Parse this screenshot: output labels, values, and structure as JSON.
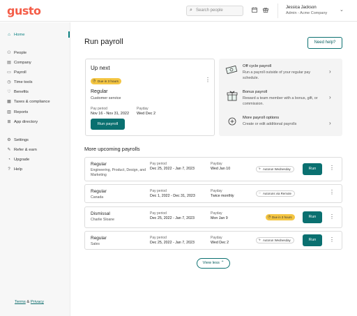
{
  "brand": {
    "logo_text": "gusto",
    "accent": "#f45d48",
    "primary": "#0a7070"
  },
  "topbar": {
    "search_placeholder": "Search people",
    "search_icon": "search-icon",
    "calendar_icon": "calendar-icon",
    "gift_icon": "gift-icon",
    "user_name": "Jessica Jackson",
    "user_company": "Admin - Acme Company",
    "chevron": "chevron-down-icon"
  },
  "sidebar": {
    "items": [
      {
        "label": "Home",
        "icon": "home-icon",
        "active": true
      },
      {
        "label": "People",
        "icon": "people-icon"
      },
      {
        "label": "Company",
        "icon": "company-icon"
      },
      {
        "label": "Payroll",
        "icon": "payroll-icon"
      },
      {
        "label": "Time tools",
        "icon": "clock-icon"
      },
      {
        "label": "Benefits",
        "icon": "heart-icon"
      },
      {
        "label": "Taxes & compliance",
        "icon": "taxes-icon"
      },
      {
        "label": "Reports",
        "icon": "reports-icon"
      },
      {
        "label": "App directory",
        "icon": "apps-icon"
      },
      {
        "label": "Settings",
        "icon": "gear-icon"
      },
      {
        "label": "Refer & earn",
        "icon": "refer-icon"
      },
      {
        "label": "Upgrade",
        "icon": "upgrade-icon"
      },
      {
        "label": "Help",
        "icon": "help-icon"
      }
    ],
    "footer": {
      "terms": "Terms",
      "amp": "&",
      "privacy": "Privacy"
    }
  },
  "main": {
    "title": "Run payroll",
    "help_button": "Need help?",
    "up_next": {
      "title": "Up next",
      "badge": "Due in 3 hours",
      "type": "Regular",
      "description": "Customer service",
      "pay_period_label": "Pay period",
      "pay_period": "Nov 16 - Nov 31, 2022",
      "payday_label": "Payday",
      "payday": "Wed Dec 2",
      "run_button": "Run payroll"
    },
    "options": [
      {
        "title": "Off cycle payroll",
        "description": "Run a payroll outside of your regular pay schedule.",
        "icon": "money-icon"
      },
      {
        "title": "Bonus payroll",
        "description": "Reward a team member with a bonus, gift, or commission.",
        "icon": "gift-box-icon"
      },
      {
        "title": "More payroll options",
        "description": "Create or edit additional payrolls",
        "icon": "plus-circle-icon"
      }
    ],
    "upcoming_title": "More upcoming payrolls",
    "upcoming": [
      {
        "type": "Regular",
        "desc": "Engineering, Product, Design, and Marketing",
        "pay_period_label": "Pay period",
        "pay_period": "Dec 25, 2022 - Jan 7, 2023",
        "payday_label": "Payday",
        "payday": "Wed Jan 10",
        "chip": "Autorun Wednesday",
        "chip_style": "grey",
        "has_run": true
      },
      {
        "type": "Regular",
        "desc": "Canada",
        "pay_period_label": "Pay period",
        "pay_period": "Dec 1, 2022 - Dec 31, 2023",
        "payday_label": "Payday",
        "payday": "Twice monthly",
        "chip": "Autoruns via Remote",
        "chip_style": "grey",
        "has_run": false
      },
      {
        "type": "Dismissal",
        "desc": "Charlie Sloane",
        "pay_period_label": "Pay period",
        "pay_period": "Dec 25, 2022 - Jan 7, 2023",
        "payday_label": "Payday",
        "payday": "Mon Jan 9",
        "chip": "Due in 3 hours",
        "chip_style": "yellow",
        "has_run": true
      },
      {
        "type": "Regular",
        "desc": "Sales",
        "pay_period_label": "Pay period",
        "pay_period": "Dec 25, 2022 - Jan 7, 2023",
        "payday_label": "Payday",
        "payday": "Wed Dec 2",
        "chip": "Autorun Wednesday",
        "chip_style": "grey",
        "has_run": true
      }
    ],
    "run_label": "Run",
    "view_less": "View less"
  }
}
